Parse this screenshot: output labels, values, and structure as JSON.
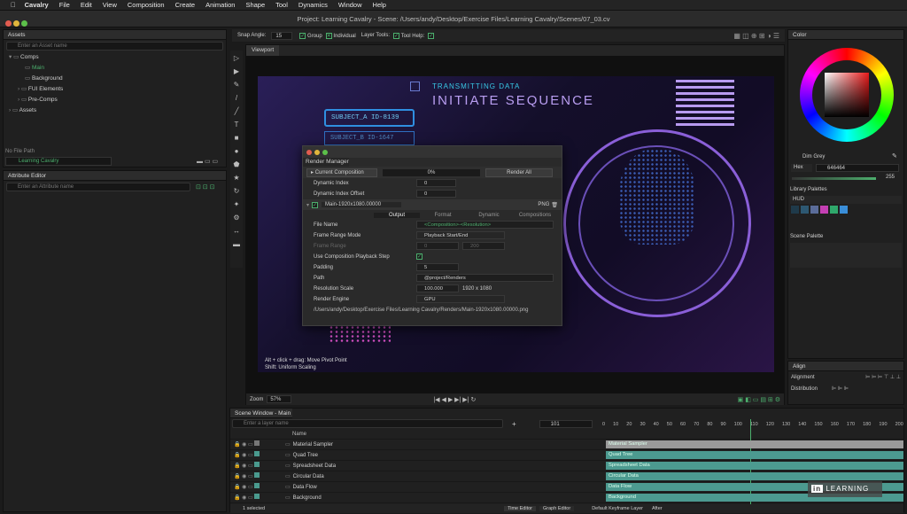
{
  "menu": [
    "Cavalry",
    "File",
    "Edit",
    "View",
    "Composition",
    "Create",
    "Animation",
    "Shape",
    "Tool",
    "Dynamics",
    "Window",
    "Help"
  ],
  "title": "Project: Learning Cavalry - Scene: /Users/andy/Desktop/Exercise Files/Learning Cavalry/Scenes/07_03.cv",
  "assets": {
    "header": "Assets",
    "search": "Enter an Asset name",
    "items": [
      "Comps",
      "Main",
      "Background",
      "FUI Elements",
      "Pre-Comps",
      "Assets"
    ],
    "file_path_label": "No File Path",
    "project": "Learning Cavalry"
  },
  "attr": {
    "header": "Attribute Editor",
    "search": "Enter an Attribute name"
  },
  "toolbar": {
    "snap_angle": "Snap Angle:",
    "snap_val": "15",
    "group": "Group",
    "individual": "Individual",
    "layer_tools": "Layer Tools:",
    "tool_help": "Tool Help:"
  },
  "viewport": {
    "tab": "Viewport",
    "hint1": "Alt + click + drag: Move Pivot Point",
    "hint2": "Shift: Uniform Scaling",
    "zoom": "Zoom",
    "zoom_val": "57%"
  },
  "art": {
    "transmitting": "TRANSMITTING DATA",
    "initiate": "INITIATE SEQUENCE",
    "subject_a": "SUBJECT_A  ID-8139",
    "subject_b": "SUBJECT_B  ID-1647"
  },
  "render": {
    "title": "Render Manager",
    "current": "Current Composition",
    "progress": "0%",
    "render_all": "Render All",
    "dyn_index": "Dynamic Index",
    "dyn_index_val": "0",
    "dyn_offset": "Dynamic Index Offset",
    "dyn_offset_val": "0",
    "item": "Main-1920x1080.00000",
    "format_badge": "PNG",
    "tabs": [
      "Output",
      "Format",
      "Dynamic",
      "Compositions"
    ],
    "file_name": "File Name",
    "file_name_val": "<Composition>-<Resolution>",
    "frame_mode": "Frame Range Mode",
    "frame_mode_val": "Playback Start/End",
    "frame_range": "Frame Range",
    "fr_start": "0",
    "fr_end": "200",
    "use_comp": "Use Composition Playback Step",
    "padding": "Padding",
    "padding_val": "5",
    "path": "Path",
    "path_val": "@project/Renders",
    "res_scale": "Resolution Scale",
    "res_val": "100.000",
    "res_size": "1920 x 1080",
    "engine": "Render Engine",
    "engine_val": "GPU",
    "out_path": "/Users/andy/Desktop/Exercise Files/Learning Cavalry/Renders/Main-1920x1080.00000.png"
  },
  "color": {
    "header": "Color",
    "name": "Dim Grey",
    "mode": "Hex",
    "hex": "646464",
    "alpha": "255",
    "lib": "Library Palettes",
    "lib_sel": "HUD",
    "scene_pal": "Scene Palette",
    "swatches": [
      "#1f3a4a",
      "#2d5872",
      "#5a6c99",
      "#c43fb3",
      "#2fa86b",
      "#3a8ed8"
    ]
  },
  "align": {
    "header": "Align",
    "alignment": "Alignment",
    "distribution": "Distribution"
  },
  "scene": {
    "header": "Scene Window - Main",
    "search": "Enter a layer name",
    "frame": "101",
    "name_col": "Name",
    "layers": [
      "Material Sampler",
      "Quad Tree",
      "Spreadsheet Data",
      "Circular Data",
      "Data Flow",
      "Background"
    ],
    "ruler": [
      "0",
      "10",
      "20",
      "30",
      "40",
      "50",
      "60",
      "70",
      "80",
      "90",
      "100",
      "110",
      "120",
      "130",
      "140",
      "150",
      "160",
      "170",
      "180",
      "190",
      "200"
    ],
    "status": "1 selected",
    "time_editor": "Time Editor",
    "graph_editor": "Graph Editor",
    "keyframe": "Default Keyframe Layer",
    "after": "After"
  },
  "watermark": "LEARNING"
}
